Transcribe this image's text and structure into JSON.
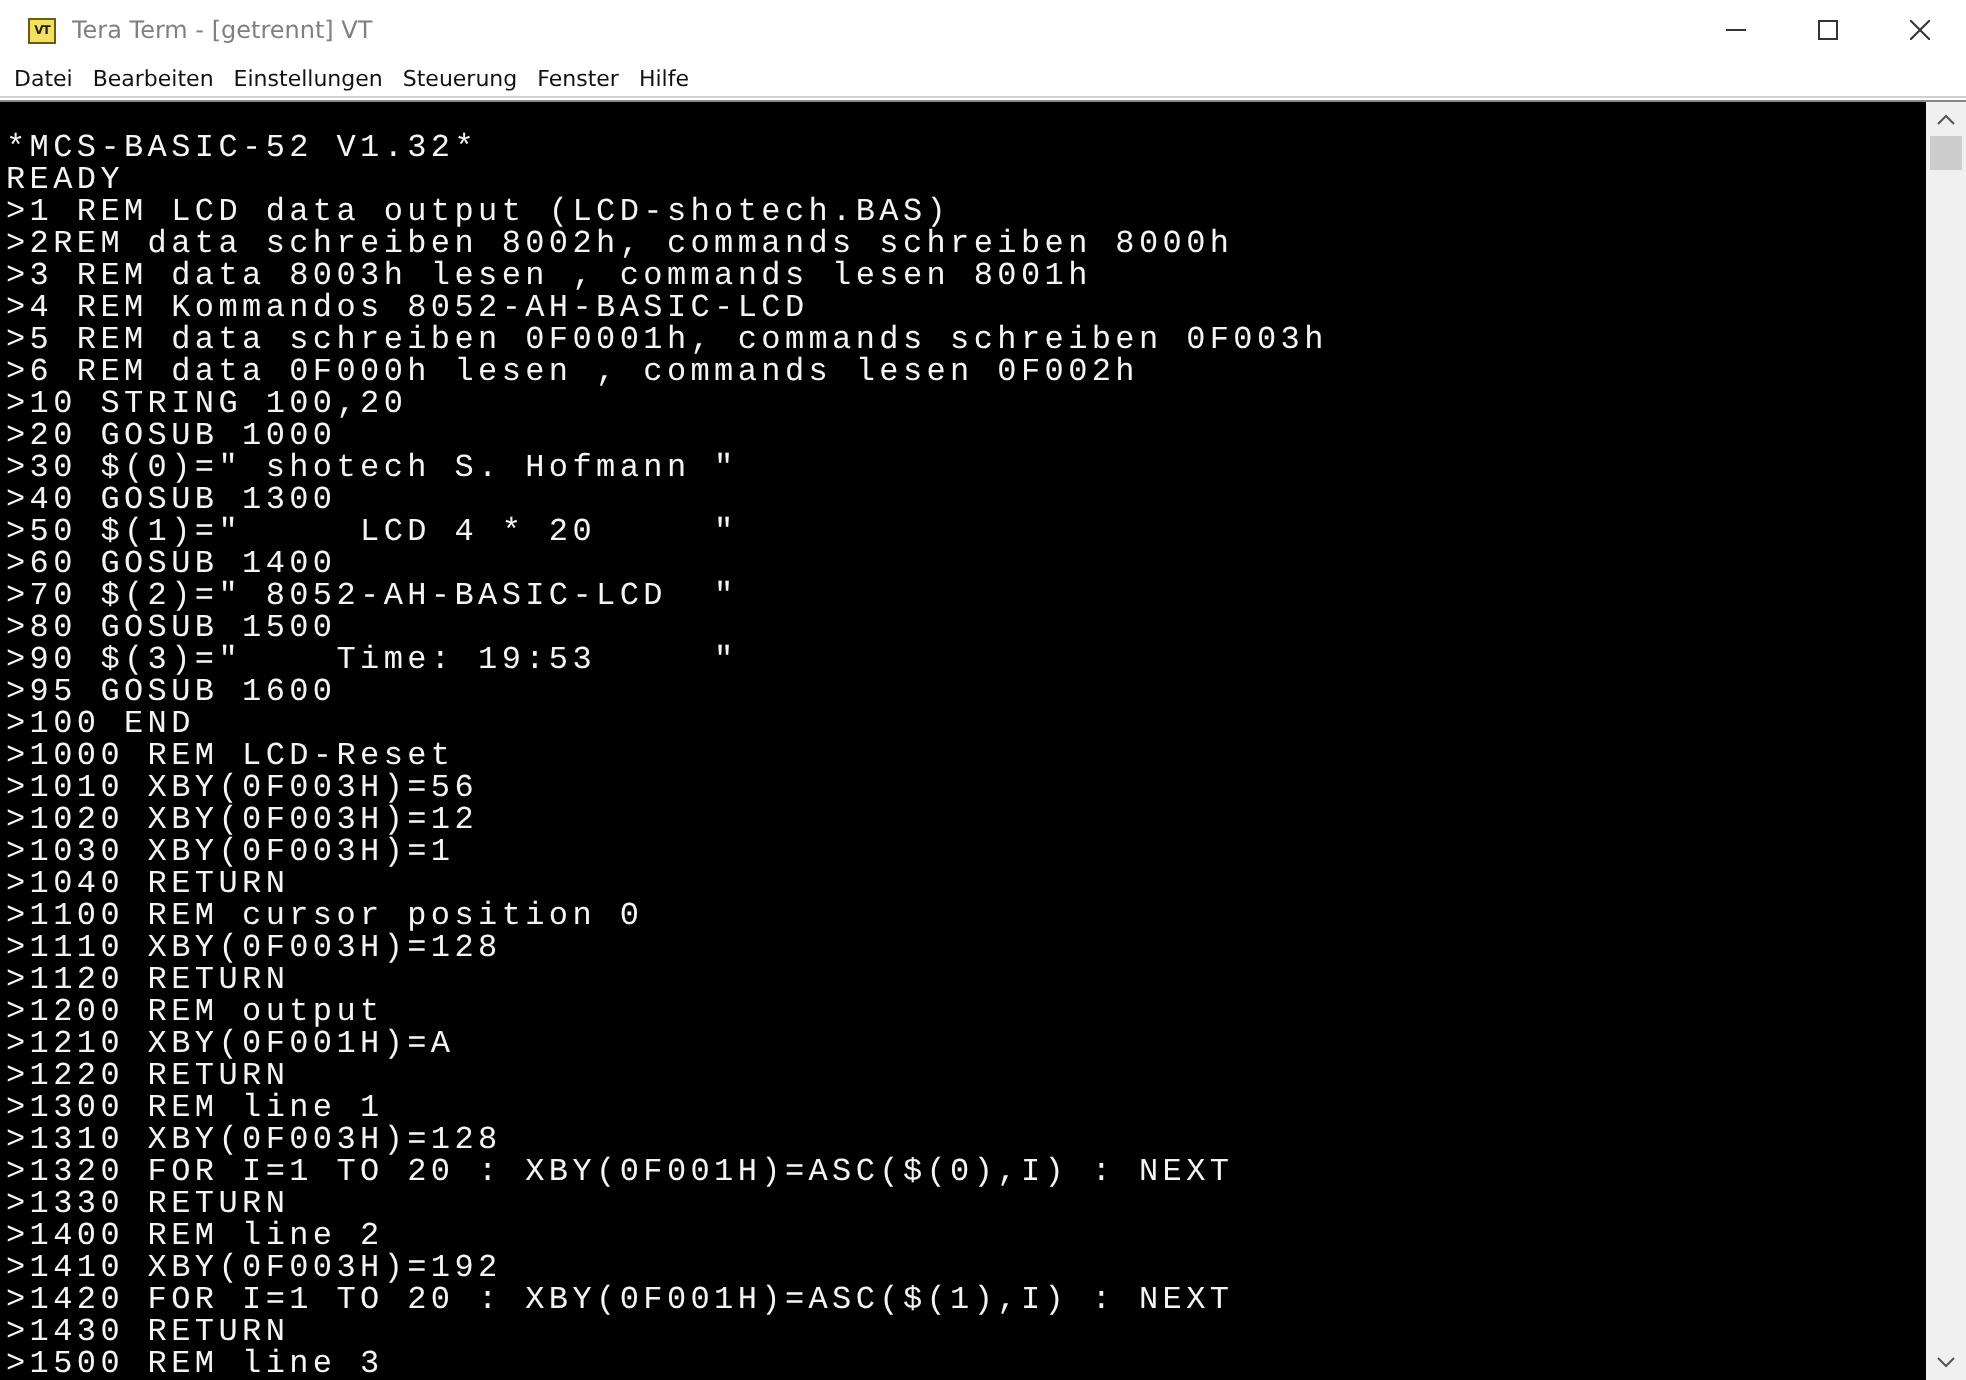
{
  "window": {
    "title": "Tera Term - [getrennt] VT",
    "icon_text": "VT"
  },
  "menu": [
    "Datei",
    "Bearbeiten",
    "Einstellungen",
    "Steuerung",
    "Fenster",
    "Hilfe"
  ],
  "terminal": {
    "lines": [
      "*MCS-BASIC-52 V1.32*",
      "READY",
      ">1 REM LCD data output (LCD-shotech.BAS)",
      ">2REM data schreiben 8002h, commands schreiben 8000h",
      ">3 REM data 8003h lesen , commands lesen 8001h",
      ">4 REM Kommandos 8052-AH-BASIC-LCD",
      ">5 REM data schreiben 0F0001h, commands schreiben 0F003h",
      ">6 REM data 0F000h lesen , commands lesen 0F002h",
      ">10 STRING 100,20",
      ">20 GOSUB 1000",
      ">30 $(0)=\" shotech S. Hofmann \"",
      ">40 GOSUB 1300",
      ">50 $(1)=\"     LCD 4 * 20     \"",
      ">60 GOSUB 1400",
      ">70 $(2)=\" 8052-AH-BASIC-LCD  \"",
      ">80 GOSUB 1500",
      ">90 $(3)=\"    Time: 19:53     \"",
      ">95 GOSUB 1600",
      ">100 END",
      ">1000 REM LCD-Reset",
      ">1010 XBY(0F003H)=56",
      ">1020 XBY(0F003H)=12",
      ">1030 XBY(0F003H)=1",
      ">1040 RETURN",
      ">1100 REM cursor position 0",
      ">1110 XBY(0F003H)=128",
      ">1120 RETURN",
      ">1200 REM output",
      ">1210 XBY(0F001H)=A",
      ">1220 RETURN",
      ">1300 REM line 1",
      ">1310 XBY(0F003H)=128",
      ">1320 FOR I=1 TO 20 : XBY(0F001H)=ASC($(0),I) : NEXT",
      ">1330 RETURN",
      ">1400 REM line 2",
      ">1410 XBY(0F003H)=192",
      ">1420 FOR I=1 TO 20 : XBY(0F001H)=ASC($(1),I) : NEXT",
      ">1430 RETURN",
      ">1500 REM line 3"
    ]
  }
}
